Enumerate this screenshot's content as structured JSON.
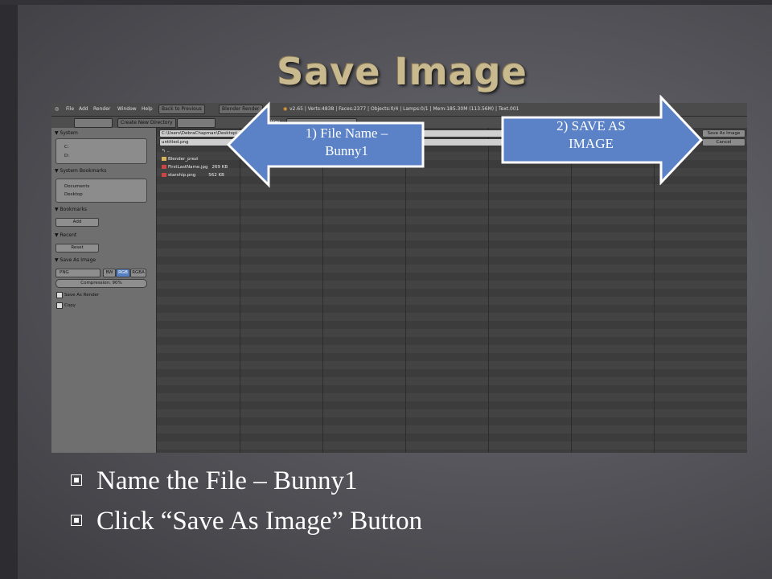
{
  "slide": {
    "title": "Save Image",
    "bullets": [
      "Name the File – Bunny1",
      "Click “Save As Image” Button"
    ],
    "colors": {
      "title": "#c9b98f",
      "arrow_fill": "#5b82c6",
      "arrow_stroke": "#ffffff"
    }
  },
  "callouts": {
    "left_arrow": {
      "text": [
        "1) File Name –",
        "Bunny1"
      ]
    },
    "right_arrow": {
      "text": [
        "2) SAVE AS",
        "IMAGE"
      ]
    }
  },
  "app": {
    "menu": [
      "File",
      "Add",
      "Render",
      "Window",
      "Help"
    ],
    "back_button": "Back to Previous",
    "render_engine": "Blender Render",
    "stats": "v2.65 | Verts:4838 | Faces:2377 | Objects:0/4 | Lamps:0/1 | Mem:185.30M (113.56M) | Text.001",
    "create_dir_button": "Create New Directory",
    "path_value": "C:\\Users\\DebraChapman\\Desktop\\",
    "filename_value": "untitled.png",
    "save_button": "Save As Image",
    "cancel_button": "Cancel",
    "hidden_label": "Hidden",
    "sidebar": {
      "system_label": "System",
      "drives": [
        "C:",
        "D:"
      ],
      "bookmarks_label": "System Bookmarks",
      "bookmarks": [
        "Documents",
        "Desktop"
      ],
      "user_bookmarks_label": "Bookmarks",
      "add_button": "Add",
      "recent_label": "Recent",
      "reset_button": "Reset",
      "save_as_image_label": "Save As Image",
      "format_value": "PNG",
      "color_modes": [
        "BW",
        "RGB",
        "RGBA"
      ],
      "compression": "Compression: 90%",
      "save_as_render": "Save As Render",
      "copy": "Copy"
    },
    "files": [
      {
        "name": "..",
        "size": ""
      },
      {
        "name": "Blender_prezi",
        "size": ""
      },
      {
        "name": "FirstLastName.jpg",
        "size": "269 KB"
      },
      {
        "name": "starship.png",
        "size": "562 KB"
      }
    ]
  }
}
